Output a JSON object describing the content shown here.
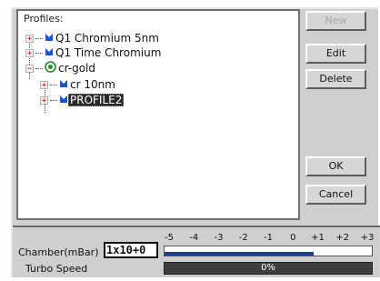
{
  "tree": {
    "title": "Profiles:",
    "nodes": [
      {
        "label": "Q1 Chromium 5nm",
        "expander": "+"
      },
      {
        "label": "Q1 Time Chromium",
        "expander": "+"
      },
      {
        "label": "cr-gold",
        "expander": "−"
      },
      {
        "label": "cr 10nm",
        "expander": "+"
      },
      {
        "label": "PROFILE2",
        "expander": "+",
        "selected": true
      }
    ]
  },
  "buttons": {
    "new": "New",
    "edit": "Edit",
    "delete": "Delete",
    "ok": "OK",
    "cancel": "Cancel"
  },
  "status": {
    "chamber_label": "Chamber(mBar)",
    "pressure_value": "1x10+0",
    "scale_ticks": [
      "-5",
      "-4",
      "-3",
      "-2",
      "-1",
      "0",
      "+1",
      "+2",
      "+3"
    ],
    "pressure_fraction": 0.72,
    "turbo_label": "Turbo Speed",
    "turbo_value": "0%"
  },
  "colors": {
    "gauge_fill": "#1b3f8f",
    "expander": "#e00000",
    "flag_blue": "#1b4fd8",
    "folder_green": "#1f8a2e"
  }
}
